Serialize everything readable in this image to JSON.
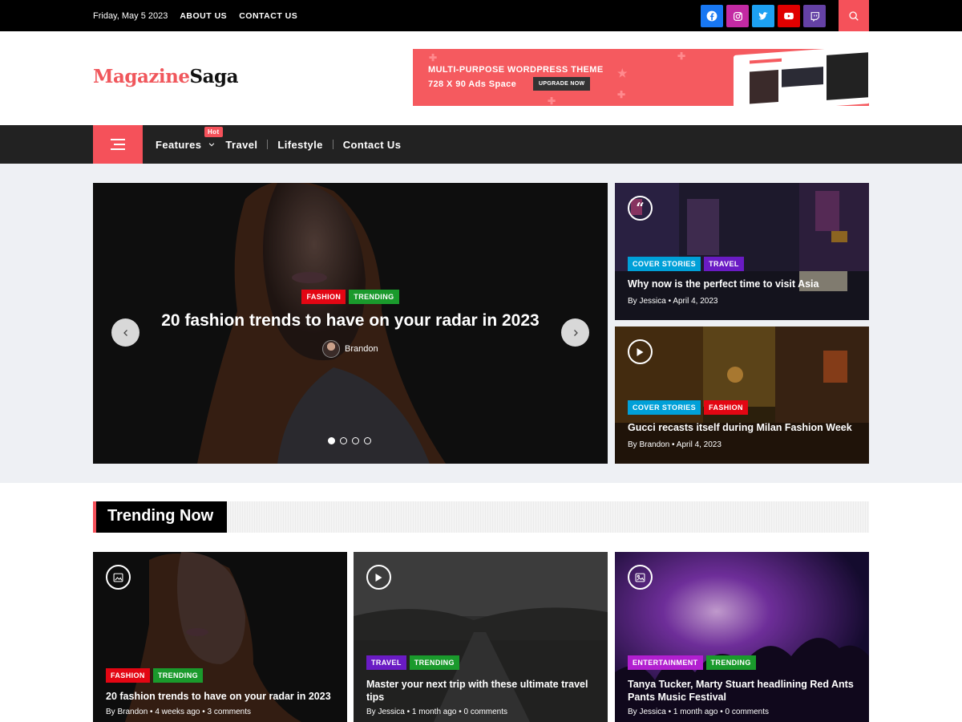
{
  "topbar": {
    "date": "Friday, May 5 2023",
    "links": [
      "ABOUT US",
      "CONTACT US"
    ],
    "social": [
      {
        "icon": "facebook-icon",
        "color": "#1877f2"
      },
      {
        "icon": "instagram-icon",
        "color": "#c32aa3"
      },
      {
        "icon": "twitter-icon",
        "color": "#1da1f2"
      },
      {
        "icon": "youtube-icon",
        "color": "#e00000"
      },
      {
        "icon": "twitch-icon",
        "color": "#6441a5"
      }
    ],
    "search_icon": "search-icon"
  },
  "header": {
    "logo_part1": "Magazine",
    "logo_part2": "Saga",
    "ad": {
      "line1": "MULTI-PURPOSE WORDPRESS THEME",
      "line2": "728 X 90 Ads Space",
      "button": "UPGRADE NOW"
    }
  },
  "nav": {
    "items": [
      "Features",
      "Travel",
      "Lifestyle",
      "Contact Us"
    ],
    "hot_badge": "Hot"
  },
  "hero": {
    "slide": {
      "tags": [
        "FASHION",
        "TRENDING"
      ],
      "title": "20 fashion trends to have on your radar in 2023",
      "author": "Brandon",
      "dot_count": 4,
      "active_dot": 1
    },
    "side": [
      {
        "icon": "quote-icon",
        "tags": [
          "COVER STORIES",
          "TRAVEL"
        ],
        "title": "Why now is the perfect time to visit Asia",
        "by": "By",
        "author": "Jessica",
        "date": "April 4, 2023"
      },
      {
        "icon": "play-icon",
        "tags": [
          "COVER STORIES",
          "FASHION"
        ],
        "title": "Gucci recasts itself during Milan Fashion Week",
        "by": "By",
        "author": "Brandon",
        "date": "April 4, 2023"
      }
    ]
  },
  "trending": {
    "heading": "Trending Now",
    "cards": [
      {
        "icon": "image-icon",
        "tags": [
          "FASHION",
          "TRENDING"
        ],
        "title": "20 fashion trends to have on your radar in 2023",
        "by": "By",
        "author": "Brandon",
        "time": "4 weeks ago",
        "comments": "3 comments"
      },
      {
        "icon": "play-icon",
        "tags": [
          "TRAVEL",
          "TRENDING"
        ],
        "title": "Master your next trip with these ultimate travel tips",
        "by": "By",
        "author": "Jessica",
        "time": "1 month ago",
        "comments": "0 comments"
      },
      {
        "icon": "gallery-icon",
        "tags": [
          "ENTERTAINMENT",
          "TRENDING"
        ],
        "title": "Tanya Tucker, Marty Stuart headlining Red Ants Pants Music Festival",
        "by": "By",
        "author": "Jessica",
        "time": "1 month ago",
        "comments": "0 comments"
      }
    ]
  }
}
